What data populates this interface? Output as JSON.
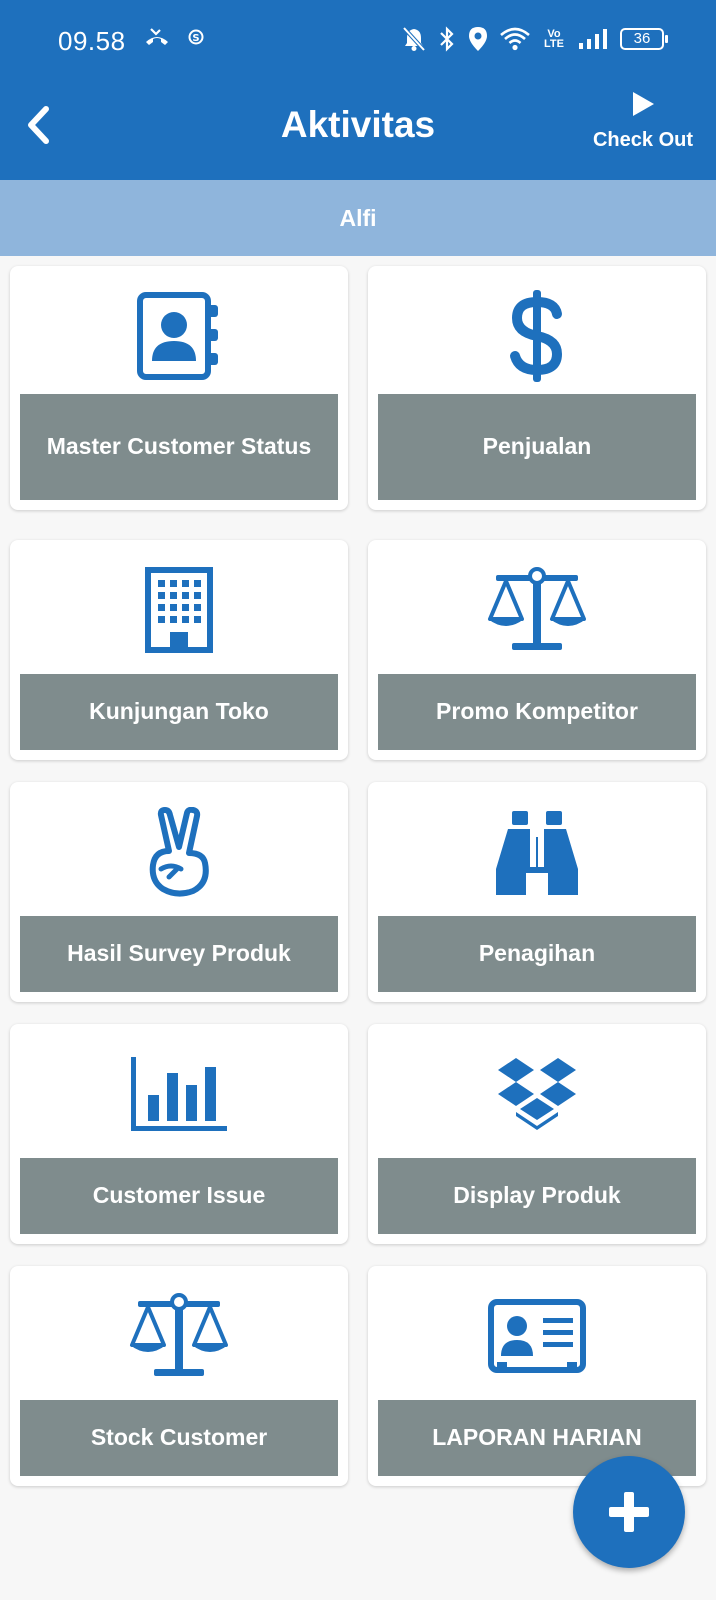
{
  "status_bar": {
    "time": "09.58",
    "battery": "36",
    "volte": "Vo LTE"
  },
  "header": {
    "title": "Aktivitas",
    "checkout_label": "Check Out"
  },
  "user": {
    "name": "Alfi"
  },
  "menu": [
    {
      "label": "Master Customer Status",
      "icon": "contact-book-icon"
    },
    {
      "label": "Penjualan",
      "icon": "dollar-icon"
    },
    {
      "label": "Kunjungan Toko",
      "icon": "building-icon"
    },
    {
      "label": "Promo Kompetitor",
      "icon": "balance-scale-icon"
    },
    {
      "label": "Hasil Survey Produk",
      "icon": "peace-hand-icon"
    },
    {
      "label": "Penagihan",
      "icon": "binoculars-icon"
    },
    {
      "label": "Customer Issue",
      "icon": "bar-chart-icon"
    },
    {
      "label": "Display Produk",
      "icon": "dropbox-icon"
    },
    {
      "label": "Stock Customer",
      "icon": "balance-scale-icon"
    },
    {
      "label": "LAPORAN HARIAN",
      "icon": "id-card-icon"
    }
  ],
  "colors": {
    "primary": "#1e70bd",
    "user_strip": "#8fb5dc",
    "card_label": "#7f8c8d",
    "background": "#f7f7f7"
  }
}
